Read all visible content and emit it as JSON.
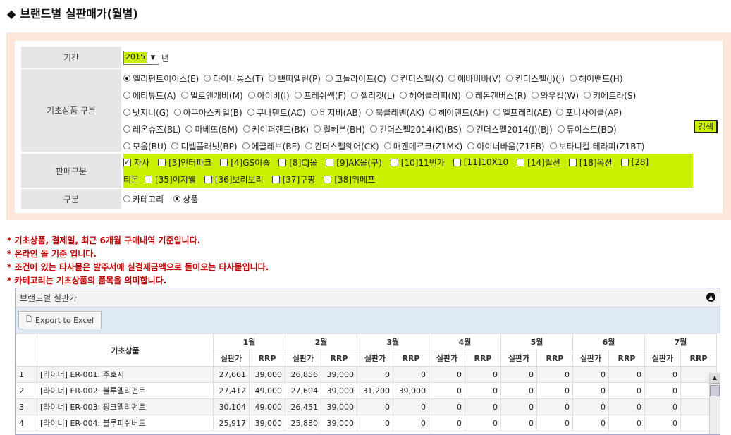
{
  "page": {
    "title": "브랜드별 실판매가(월별)",
    "title_marker": "◆"
  },
  "filters": {
    "period": {
      "label": "기간",
      "year": "2015",
      "unit": "년"
    },
    "base_product": {
      "label": "기초상품 구분",
      "lines": [
        [
          {
            "text": "엘리펀트이어스(E)",
            "checked": true
          },
          {
            "text": "타이니통스(T)"
          },
          {
            "text": "쁘띠엘린(P)"
          },
          {
            "text": "코들라이프(C)"
          },
          {
            "text": "킨더스펠(K)"
          },
          {
            "text": "에바비바(V)"
          },
          {
            "text": "킨더스펠(J)(J)"
          },
          {
            "text": "헤어밴드(H)"
          }
        ],
        [
          {
            "text": "에티튜드(A)"
          },
          {
            "text": "밀로앤개비(M)"
          },
          {
            "text": "아이비(I)"
          },
          {
            "text": "프레쉬쌕(F)"
          },
          {
            "text": "젤리캣(L)"
          },
          {
            "text": "헤어클리피(N)"
          },
          {
            "text": "레몬캔버스(R)"
          },
          {
            "text": "와우컵(W)"
          },
          {
            "text": "키에트라(S)"
          }
        ],
        [
          {
            "text": "낫지니(G)"
          },
          {
            "text": "아쿠아스케일(B)"
          },
          {
            "text": "쿠나텐트(AC)"
          },
          {
            "text": "비지비(AB)"
          },
          {
            "text": "북클레벤(AK)"
          },
          {
            "text": "헤이랜드(AH)"
          },
          {
            "text": "엘프레리(AE)"
          },
          {
            "text": "포니사이클(AP)"
          }
        ],
        [
          {
            "text": "레온슈즈(BL)"
          },
          {
            "text": "마베뜨(BM)"
          },
          {
            "text": "케이퍼랜드(BK)"
          },
          {
            "text": "릴헤븐(BH)"
          },
          {
            "text": "킨더스펠2014(K)(BS)"
          },
          {
            "text": "킨더스펠2014(J)(BJ)"
          },
          {
            "text": "듀이스트(BD)"
          }
        ],
        [
          {
            "text": "모음(BU)"
          },
          {
            "text": "디벨플래닛(BP)"
          },
          {
            "text": "에끌레브(BE)"
          },
          {
            "text": "킨더스펠웨어(CK)"
          },
          {
            "text": "매켄메르크(Z1MK)"
          },
          {
            "text": "아이너바움(Z1EB)"
          },
          {
            "text": "보타니컬 테라피(Z1BT)"
          }
        ]
      ]
    },
    "sales_type": {
      "label": "판매구분",
      "line1": [
        {
          "text": "자사",
          "checked": true
        },
        {
          "text": "[3]인터파크"
        },
        {
          "text": "[4]GS이숍"
        },
        {
          "text": "[8]CJ몰"
        },
        {
          "text": "[9]AK몰(구)"
        },
        {
          "text": "[10]11번가"
        },
        {
          "text": "[11]10X10"
        },
        {
          "text": "[14]릴션"
        },
        {
          "text": "[18]옥션"
        },
        {
          "text": "[28]"
        }
      ],
      "line2_prefix": "티몬",
      "line2": [
        {
          "text": "[35]이지웰"
        },
        {
          "text": "[36]보리보리"
        },
        {
          "text": "[37]쿠팡"
        },
        {
          "text": "[38]위메프"
        }
      ]
    },
    "division": {
      "label": "구분",
      "options": [
        {
          "text": "카테고리"
        },
        {
          "text": "상품",
          "checked": true
        }
      ]
    },
    "search_label": "검색"
  },
  "notes": [
    "* 기초상품, 결제일, 최근 6개월 구매내역 기준입니다.",
    "* 온라인 몰 기준 입니다.",
    "* 조건에 있는 타사몰은 발주서에 실결제금액으로 들어오는 타사몰입니다.",
    "* 카테고리는 기초상품의 품목을 의미합니다."
  ],
  "grid": {
    "title": "브랜드별 실판가",
    "export_label": "Export to Excel",
    "product_header": "기초상품",
    "months": [
      "1월",
      "2월",
      "3월",
      "4월",
      "5월",
      "6월",
      "7월"
    ],
    "sub_headers": [
      "실판가",
      "RRP"
    ],
    "rows": [
      {
        "idx": "1",
        "name": "[라이너] ER-001: 주호지",
        "vals": [
          "27,661",
          "39,000",
          "26,856",
          "39,000",
          "0",
          "0",
          "0",
          "0",
          "0",
          "0",
          "0",
          "0",
          "0",
          ""
        ]
      },
      {
        "idx": "2",
        "name": "[라이너] ER-002: 블루엘리펀트",
        "vals": [
          "27,412",
          "49,000",
          "27,604",
          "39,000",
          "31,200",
          "39,000",
          "0",
          "0",
          "0",
          "0",
          "0",
          "0",
          "0",
          ""
        ]
      },
      {
        "idx": "3",
        "name": "[라이너] ER-003: 핑크엘리펀트",
        "vals": [
          "30,104",
          "49,000",
          "26,451",
          "39,000",
          "0",
          "0",
          "0",
          "0",
          "0",
          "0",
          "0",
          "0",
          "0",
          ""
        ]
      },
      {
        "idx": "4",
        "name": "[라이너] ER-004: 블루피쉬버드",
        "vals": [
          "25,917",
          "39,000",
          "25,880",
          "39,000",
          "0",
          "0",
          "0",
          "0",
          "0",
          "0",
          "0",
          "0",
          "0",
          ""
        ]
      }
    ]
  }
}
